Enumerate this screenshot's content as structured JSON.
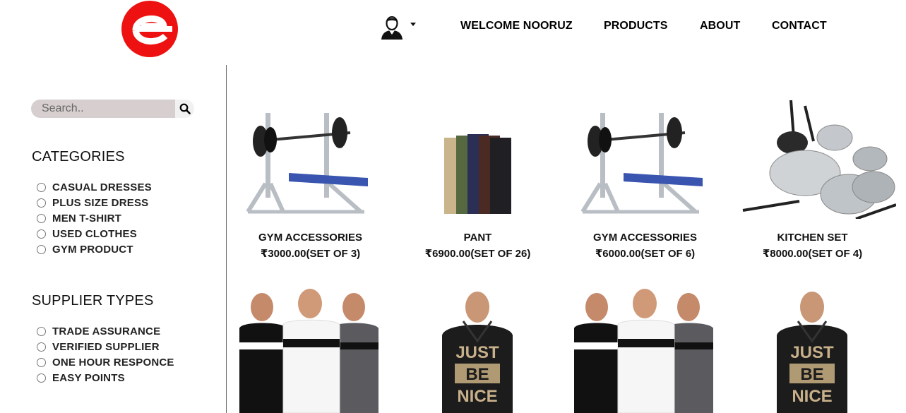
{
  "header": {
    "logo_alt": "logo",
    "nav": {
      "welcome": "WELCOME NOORUZ",
      "products": "PRODUCTS",
      "about": "ABOUT",
      "contact": "CONTACT"
    }
  },
  "search": {
    "placeholder": "Search.."
  },
  "categories": {
    "title": "CATEGORIES",
    "items": [
      "CASUAL DRESSES",
      "PLUS SIZE DRESS",
      "MEN T-SHIRT",
      "USED CLOTHES",
      "GYM PRODUCT"
    ]
  },
  "supplier_types": {
    "title": "SUPPLIER TYPES",
    "items": [
      "TRADE ASSURANCE",
      "VERIFIED SUPPLIER",
      "ONE HOUR RESPONCE",
      "EASY POINTS"
    ]
  },
  "products": [
    {
      "name": "GYM ACCESSORIES",
      "price": "₹3000.00(SET OF 3)",
      "image": "gym-bench"
    },
    {
      "name": "PANT",
      "price": "₹6900.00(SET OF 26)",
      "image": "pants-stack"
    },
    {
      "name": "GYM ACCESSORIES",
      "price": "₹6000.00(SET OF 6)",
      "image": "gym-bench"
    },
    {
      "name": "KITCHEN SET",
      "price": "₹8000.00(SET OF 4)",
      "image": "cookware-set"
    },
    {
      "image": "men-tshirts"
    },
    {
      "image": "hoodie",
      "hoodie_text": [
        "JUST",
        "BE",
        "NICE"
      ]
    },
    {
      "image": "men-tshirts"
    },
    {
      "image": "hoodie",
      "hoodie_text": [
        "JUST",
        "BE",
        "NICE"
      ]
    }
  ],
  "colors": {
    "logo": "#ee1111",
    "search_bg": "#d7cfcf",
    "bench_pad": "#3a55b0",
    "frame": "#b8bec4"
  }
}
